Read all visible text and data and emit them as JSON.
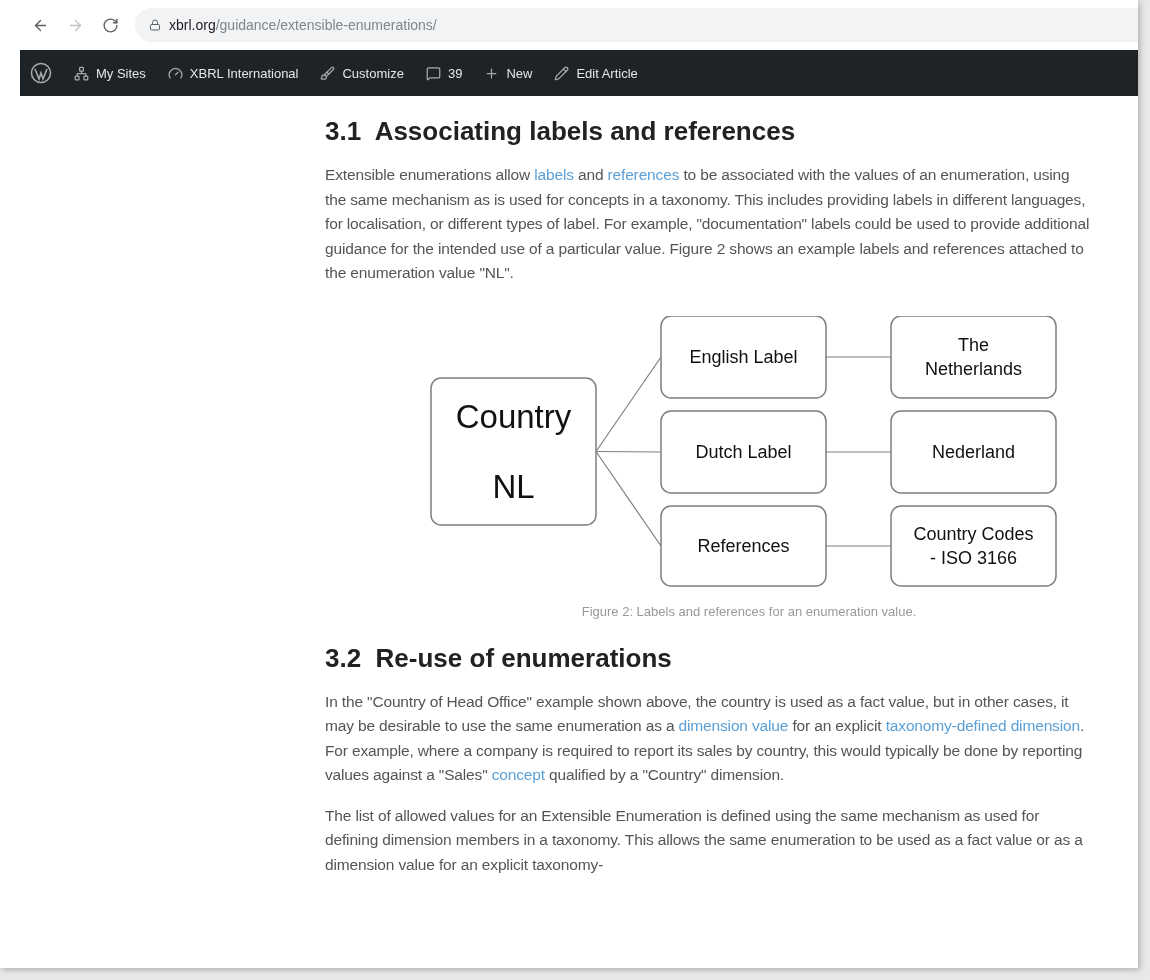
{
  "browser": {
    "nav": [
      {
        "kind": "back",
        "disabled": false
      },
      {
        "kind": "forward",
        "disabled": true
      },
      {
        "kind": "reload",
        "disabled": false
      }
    ],
    "address": {
      "domain": "xbrl.org",
      "path": "/guidance/extensible-enumerations/"
    }
  },
  "admin_bar": {
    "items": [
      {
        "kind": "logo"
      },
      {
        "kind": "sites",
        "label": "My Sites"
      },
      {
        "kind": "site",
        "label": "XBRL International"
      },
      {
        "kind": "customize",
        "label": "Customize"
      },
      {
        "kind": "comments",
        "label": "39"
      },
      {
        "kind": "new",
        "label": "New"
      },
      {
        "kind": "edit",
        "label": "Edit Article"
      }
    ]
  },
  "sections": [
    {
      "heading": "3.1  Associating labels and references",
      "blocks": [
        {
          "kind": "paragraph",
          "segments": [
            {
              "text": "Extensible enumerations allow "
            },
            {
              "text": "labels",
              "link": true
            },
            {
              "text": " and "
            },
            {
              "text": "references",
              "link": true
            },
            {
              "text": " to be associated with the values of an enumeration, using the same mechanism as is used for concepts in a taxonomy. This includes providing labels in different languages, for localisation, or different types of label. For example, \"documentation\" labels could be used to provide additional guidance for the intended use of a particular value. Figure 2 shows an example labels and references attached to the enumeration value \"NL\"."
            }
          ]
        },
        {
          "kind": "figure",
          "diagram": {
            "root": [
              "Country",
              "NL"
            ],
            "branches": [
              {
                "label": [
                  "English Label"
                ],
                "value": [
                  "The",
                  "Netherlands"
                ]
              },
              {
                "label": [
                  "Dutch Label"
                ],
                "value": [
                  "Nederland"
                ]
              },
              {
                "label": [
                  "References"
                ],
                "value": [
                  "Country Codes",
                  "- ISO 3166"
                ]
              }
            ]
          },
          "caption": "Figure 2: Labels and references for an enumeration value."
        }
      ]
    },
    {
      "heading": "3.2  Re-use of enumerations",
      "blocks": [
        {
          "kind": "paragraph",
          "segments": [
            {
              "text": "In the \"Country of Head Office\" example shown above, the country is used as a fact value, but in other cases, it may be desirable to use the same enumeration as a "
            },
            {
              "text": "dimension value",
              "link": true
            },
            {
              "text": " for an explicit "
            },
            {
              "text": "taxonomy-defined dimension",
              "link": true
            },
            {
              "text": ". For example, where a company is required to report its sales by country, this would typically be done by reporting values against a \"Sales\" "
            },
            {
              "text": "concept",
              "link": true
            },
            {
              "text": " qualified by a \"Country\" dimension."
            }
          ]
        },
        {
          "kind": "paragraph",
          "segments": [
            {
              "text": "The list of allowed values for an Extensible Enumeration is defined using the same mechanism as used for defining dimension members in a taxonomy. This allows the same enumeration to be used as a fact value or as a dimension value for an explicit taxonomy-"
            }
          ]
        }
      ]
    }
  ]
}
